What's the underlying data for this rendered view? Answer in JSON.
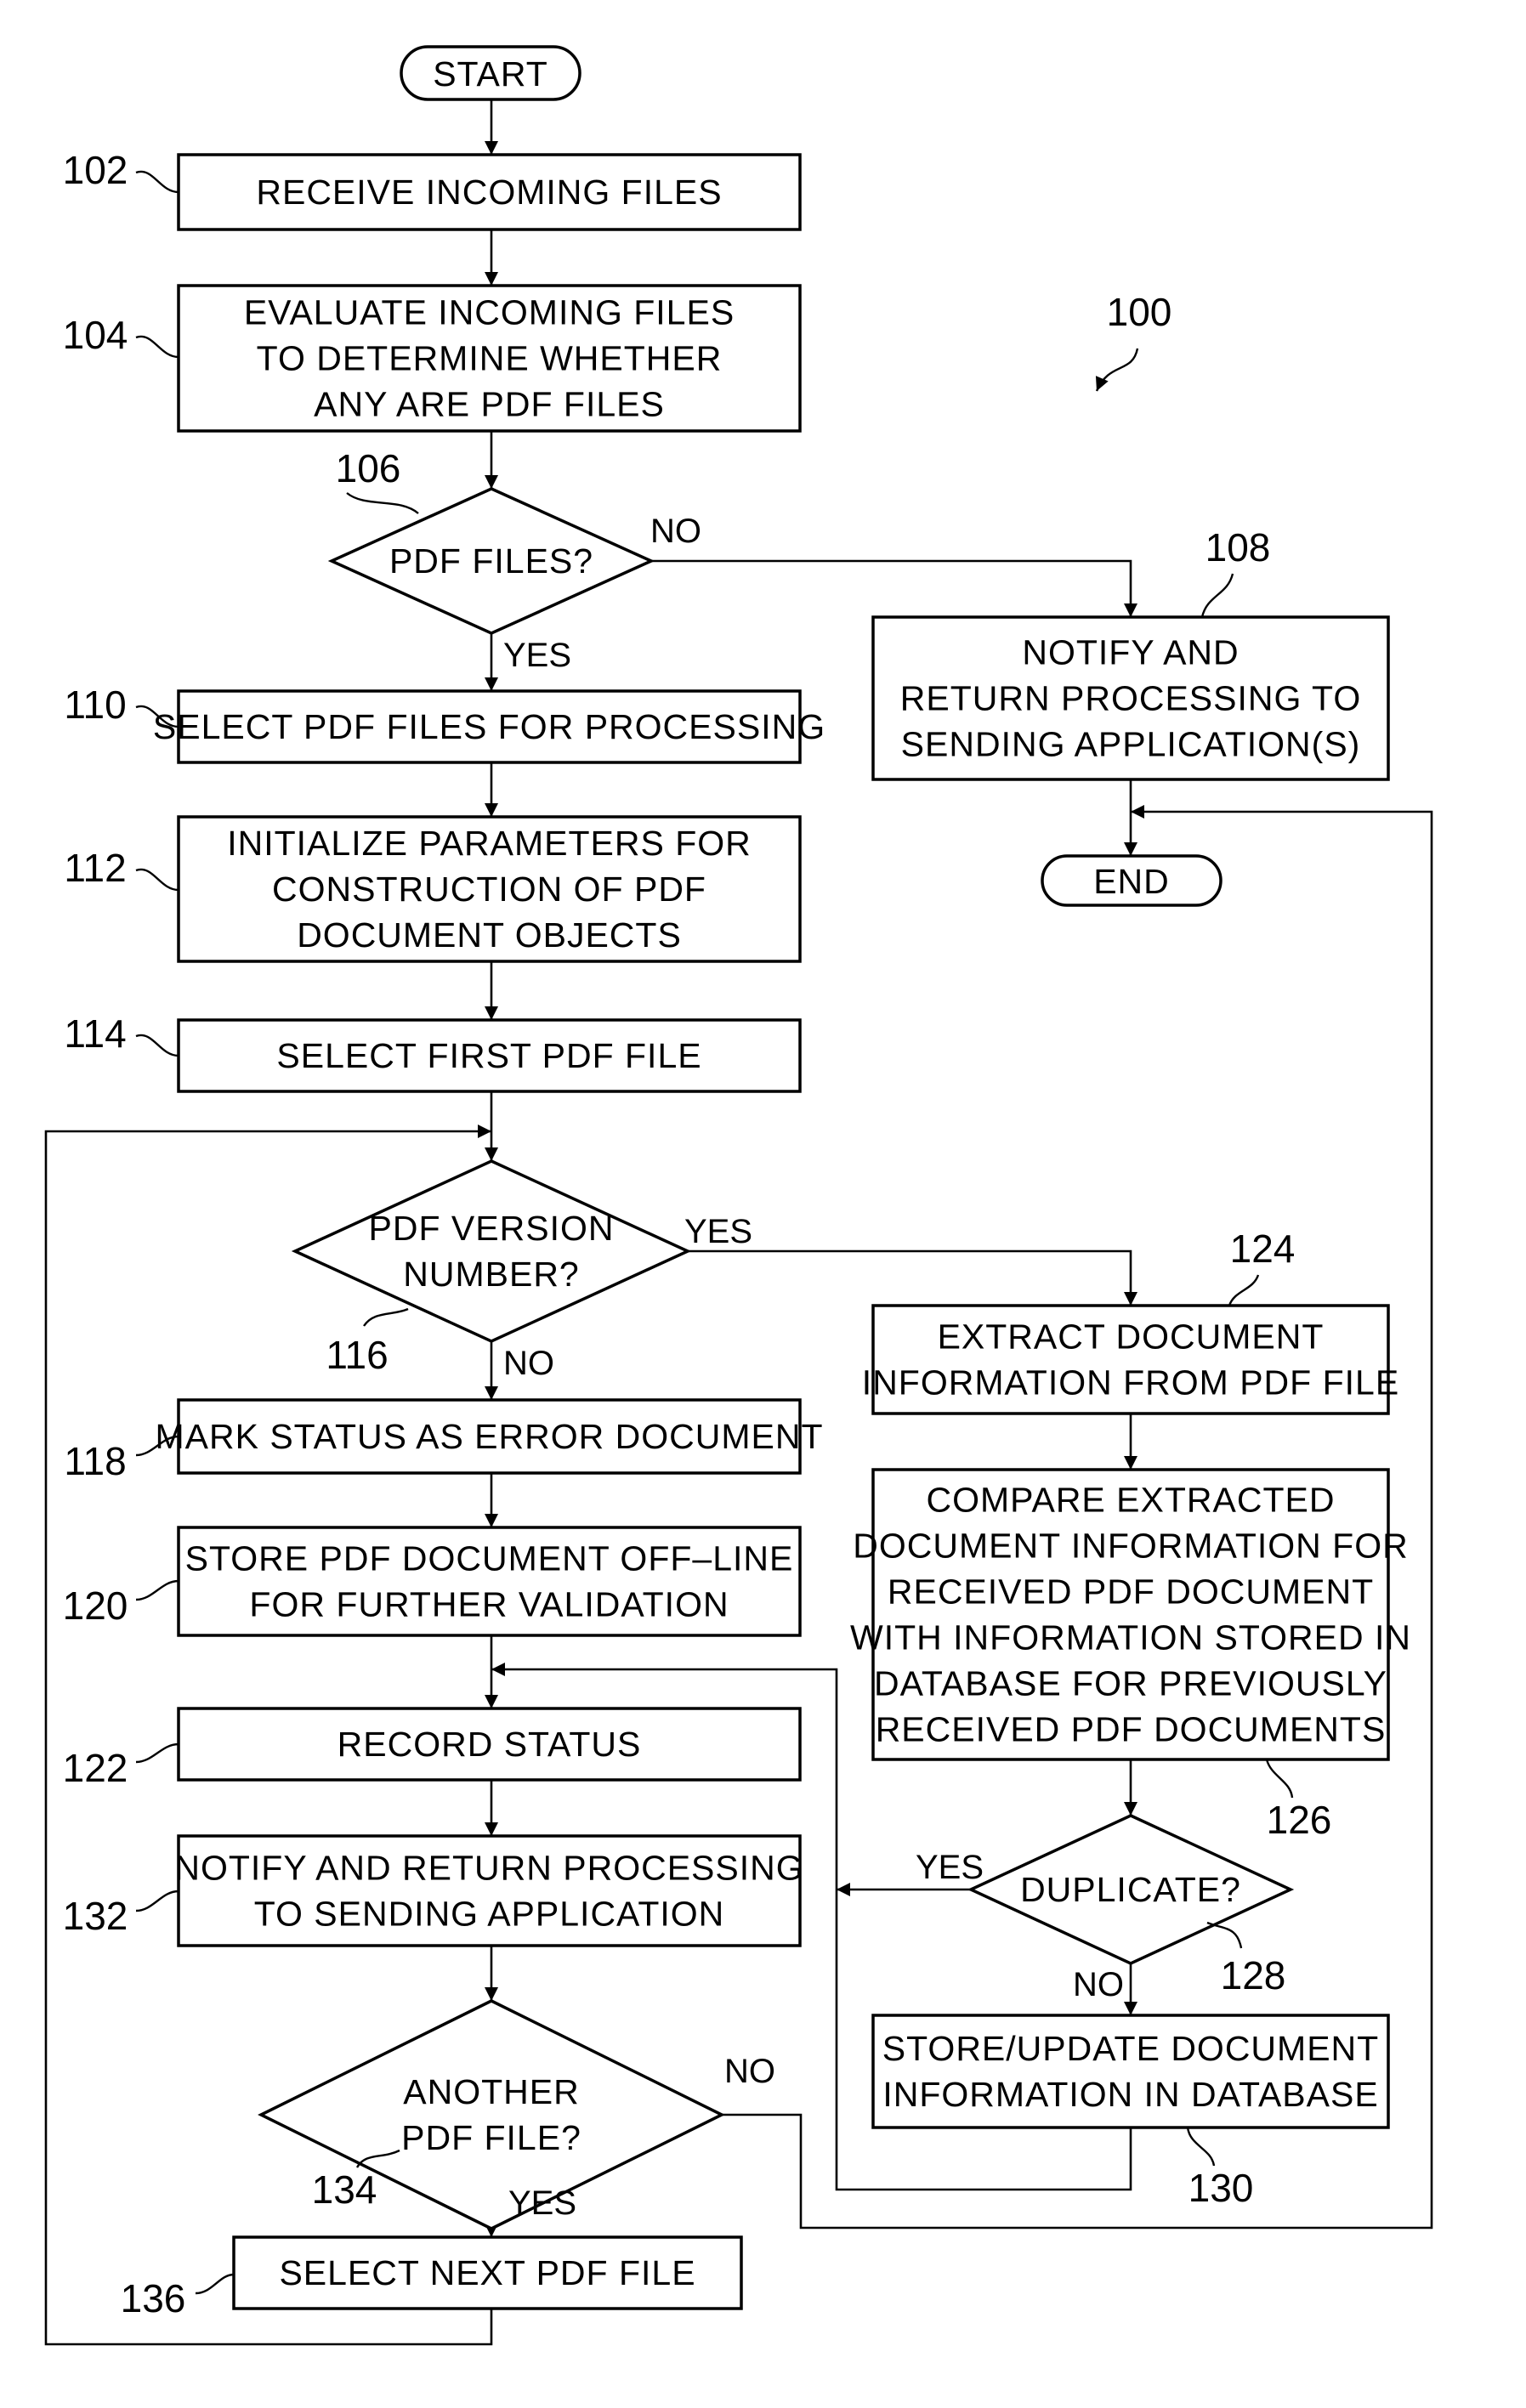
{
  "figure": {
    "ref": "100",
    "colors": {
      "ink": "#000000",
      "paper": "#ffffff"
    }
  },
  "terminals": {
    "start": "START",
    "end": "END"
  },
  "steps": {
    "s102": {
      "ref": "102",
      "lines": [
        "RECEIVE INCOMING FILES"
      ]
    },
    "s104": {
      "ref": "104",
      "lines": [
        "EVALUATE INCOMING FILES",
        "TO DETERMINE WHETHER",
        "ANY ARE PDF FILES"
      ]
    },
    "s106": {
      "ref": "106",
      "lines": [
        "PDF FILES?"
      ],
      "yes": "YES",
      "no": "NO"
    },
    "s108": {
      "ref": "108",
      "lines": [
        "NOTIFY AND",
        "RETURN PROCESSING TO",
        "SENDING APPLICATION(S)"
      ]
    },
    "s110": {
      "ref": "110",
      "lines": [
        "SELECT PDF FILES FOR PROCESSING"
      ]
    },
    "s112": {
      "ref": "112",
      "lines": [
        "INITIALIZE PARAMETERS FOR",
        "CONSTRUCTION OF PDF",
        "DOCUMENT OBJECTS"
      ]
    },
    "s114": {
      "ref": "114",
      "lines": [
        "SELECT FIRST PDF FILE"
      ]
    },
    "s116": {
      "ref": "116",
      "lines": [
        "PDF VERSION",
        "NUMBER?"
      ],
      "yes": "YES",
      "no": "NO"
    },
    "s118": {
      "ref": "118",
      "lines": [
        "MARK STATUS AS ERROR DOCUMENT"
      ]
    },
    "s120": {
      "ref": "120",
      "lines": [
        "STORE PDF DOCUMENT OFF–LINE",
        "FOR FURTHER VALIDATION"
      ]
    },
    "s122": {
      "ref": "122",
      "lines": [
        "RECORD STATUS"
      ]
    },
    "s124": {
      "ref": "124",
      "lines": [
        "EXTRACT DOCUMENT",
        "INFORMATION FROM PDF FILE"
      ]
    },
    "s126": {
      "ref": "126",
      "lines": [
        "COMPARE EXTRACTED",
        "DOCUMENT INFORMATION FOR",
        "RECEIVED PDF DOCUMENT",
        "WITH INFORMATION STORED IN",
        "DATABASE FOR PREVIOUSLY",
        "RECEIVED PDF DOCUMENTS"
      ]
    },
    "s128": {
      "ref": "128",
      "lines": [
        "DUPLICATE?"
      ],
      "yes": "YES",
      "no": "NO"
    },
    "s130": {
      "ref": "130",
      "lines": [
        "STORE/UPDATE DOCUMENT",
        "INFORMATION IN DATABASE"
      ]
    },
    "s132": {
      "ref": "132",
      "lines": [
        "NOTIFY AND RETURN PROCESSING",
        "TO SENDING APPLICATION"
      ]
    },
    "s134": {
      "ref": "134",
      "lines": [
        "ANOTHER",
        "PDF FILE?"
      ],
      "yes": "YES",
      "no": "NO"
    },
    "s136": {
      "ref": "136",
      "lines": [
        "SELECT NEXT PDF FILE"
      ]
    }
  }
}
